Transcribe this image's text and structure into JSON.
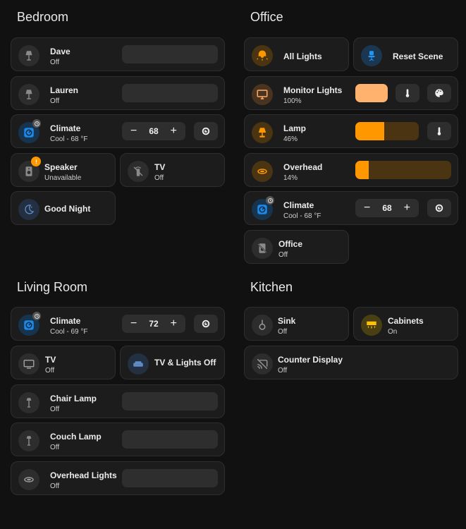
{
  "colors": {
    "background": "#111111",
    "card": "#1c1c1c",
    "accent_orange": "#ff9800",
    "accent_blue": "#1e88e5",
    "warning": "#ff9800"
  },
  "bedroom": {
    "title": "Bedroom",
    "dave": {
      "name": "Dave",
      "state": "Off",
      "icon": "floor-lamp-icon"
    },
    "lauren": {
      "name": "Lauren",
      "state": "Off",
      "icon": "floor-lamp-icon"
    },
    "climate": {
      "name": "Climate",
      "state": "Cool - 68 °F",
      "setpoint": "68",
      "minus": "−",
      "plus": "+",
      "icon": "thermostat-icon"
    },
    "speaker": {
      "name": "Speaker",
      "state": "Unavailable",
      "icon": "speaker-icon"
    },
    "tv": {
      "name": "TV",
      "state": "Off",
      "icon": "remote-off-icon"
    },
    "good_night": {
      "name": "Good Night",
      "icon": "moon-icon"
    }
  },
  "office": {
    "title": "Office",
    "all_lights": {
      "name": "All Lights",
      "icon": "ceiling-light-icon"
    },
    "reset_scene": {
      "name": "Reset Scene",
      "icon": "desk-chair-icon"
    },
    "monitor_lights": {
      "name": "Monitor Lights",
      "state": "100%",
      "level": 100,
      "icon": "monitor-icon"
    },
    "lamp": {
      "name": "Lamp",
      "state": "46%",
      "level": 46,
      "icon": "lamp-icon"
    },
    "overhead": {
      "name": "Overhead",
      "state": "14%",
      "level": 14,
      "icon": "ceiling-round-icon"
    },
    "climate": {
      "name": "Climate",
      "state": "Cool - 68 °F",
      "setpoint": "68",
      "minus": "−",
      "plus": "+",
      "icon": "thermostat-icon"
    },
    "office_switch": {
      "name": "Office",
      "state": "Off",
      "icon": "speaker-off-icon"
    }
  },
  "living_room": {
    "title": "Living Room",
    "climate": {
      "name": "Climate",
      "state": "Cool - 69 °F",
      "setpoint": "72",
      "minus": "−",
      "plus": "+",
      "icon": "thermostat-icon"
    },
    "tv": {
      "name": "TV",
      "state": "Off",
      "icon": "tv-icon"
    },
    "tv_lights_off": {
      "name": "TV & Lights Off",
      "icon": "sofa-icon"
    },
    "chair_lamp": {
      "name": "Chair Lamp",
      "state": "Off",
      "icon": "floor-lamp-icon"
    },
    "couch_lamp": {
      "name": "Couch Lamp",
      "state": "Off",
      "icon": "floor-lamp-icon"
    },
    "overhead_lights": {
      "name": "Overhead Lights",
      "state": "Off",
      "icon": "ceiling-round-icon"
    }
  },
  "kitchen": {
    "title": "Kitchen",
    "sink": {
      "name": "Sink",
      "state": "Off",
      "icon": "pendant-light-icon"
    },
    "cabinets": {
      "name": "Cabinets",
      "state": "On",
      "icon": "under-cabinet-light-icon"
    },
    "counter_display": {
      "name": "Counter Display",
      "state": "Off",
      "icon": "cast-off-icon"
    }
  }
}
